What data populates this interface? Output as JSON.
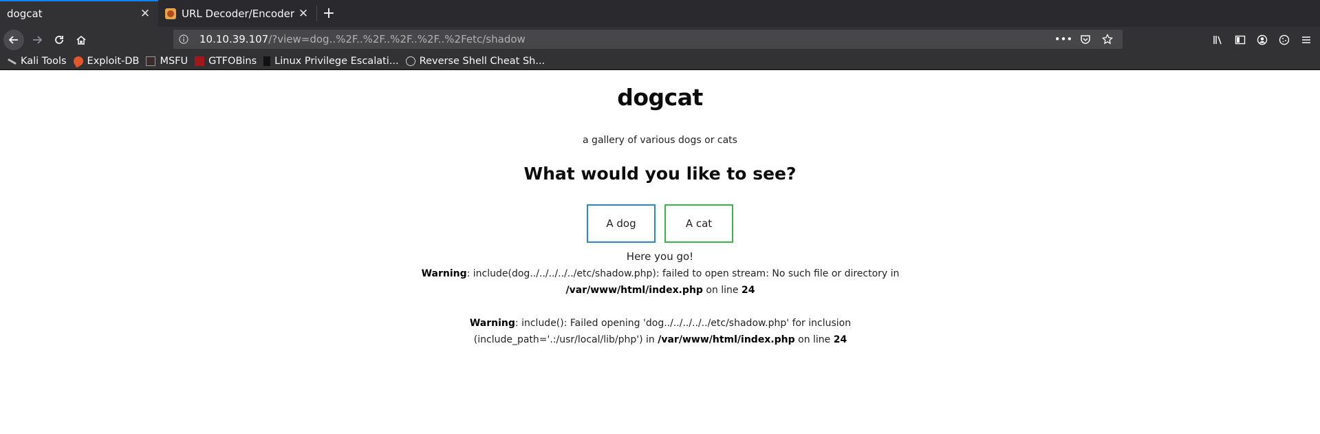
{
  "browser": {
    "tabs": [
      {
        "title": "dogcat",
        "active": true
      },
      {
        "title": "URL Decoder/Encoder",
        "active": false
      }
    ],
    "url": {
      "host": "10.10.39.107",
      "path": "/?view=dog..%2F..%2F..%2F..%2F..%2Fetc/shadow"
    },
    "bookmarks": [
      {
        "label": "Kali Tools",
        "icon": "kali-icon"
      },
      {
        "label": "Exploit-DB",
        "icon": "exploit-db-icon"
      },
      {
        "label": "MSFU",
        "icon": "msfu-icon"
      },
      {
        "label": "GTFOBins",
        "icon": "gtfobins-icon"
      },
      {
        "label": "Linux Privilege Escalati...",
        "icon": "linux-icon"
      },
      {
        "label": "Reverse Shell Cheat Sh...",
        "icon": "globe-icon"
      }
    ]
  },
  "page": {
    "title": "dogcat",
    "subtitle": "a gallery of various dogs or cats",
    "prompt": "What would you like to see?",
    "buttons": {
      "dog": "A dog",
      "cat": "A cat"
    },
    "result": "Here you go!",
    "warnings": [
      {
        "label": "Warning",
        "message": ": include(dog../../../../../etc/shadow.php): failed to open stream: No such file or directory in ",
        "file": "/var/www/html/index.php",
        "line_text": " on line ",
        "line": "24"
      },
      {
        "label": "Warning",
        "message": ": include(): Failed opening 'dog../../../../../etc/shadow.php' for inclusion (include_path='.:/usr/local/lib/php') in ",
        "file": "/var/www/html/index.php",
        "line_text": " on line ",
        "line": "24"
      }
    ]
  },
  "colors": {
    "dog_border": "#2a86c8",
    "cat_border": "#3bb34a",
    "chrome_dark": "#2a2a2e",
    "accent": "#0a84ff"
  }
}
